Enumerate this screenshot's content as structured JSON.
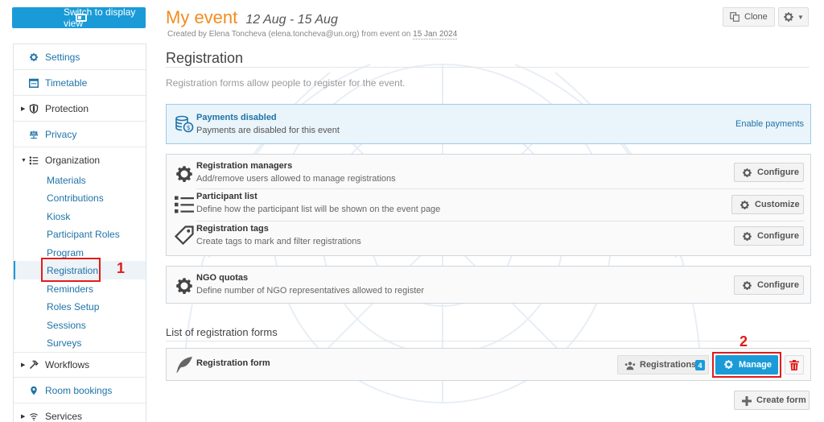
{
  "sidebar": {
    "switch_button": "Switch to display view",
    "items": [
      {
        "label": "Settings",
        "icon": "gear-icon"
      },
      {
        "label": "Timetable",
        "icon": "calendar-icon"
      },
      {
        "label": "Protection",
        "icon": "shield-icon"
      },
      {
        "label": "Privacy",
        "icon": "scales-icon"
      },
      {
        "label": "Organization",
        "icon": "list-icon"
      },
      {
        "label": "Workflows",
        "icon": "hammer-icon"
      },
      {
        "label": "Room bookings",
        "icon": "map-pin-icon"
      },
      {
        "label": "Services",
        "icon": "wifi-icon"
      }
    ],
    "organization_sub": [
      "Materials",
      "Contributions",
      "Kiosk",
      "Participant Roles",
      "Program",
      "Registration",
      "Reminders",
      "Roles Setup",
      "Sessions",
      "Surveys"
    ],
    "active": "Registration"
  },
  "markers": {
    "one": "1",
    "two": "2"
  },
  "header": {
    "title": "My event",
    "dates": "12 Aug - 15 Aug",
    "created_prefix": "Created by Elena Toncheva (elena.toncheva@un.org) from event on ",
    "created_date": "15 Jan 2024",
    "clone_label": "Clone"
  },
  "page": {
    "title": "Registration",
    "intro": "Registration forms allow people to register for the event."
  },
  "payments": {
    "title": "Payments disabled",
    "desc": "Payments are disabled for this event",
    "action": "Enable payments"
  },
  "settings_rows": [
    {
      "title": "Registration managers",
      "desc": "Add/remove users allowed to manage registrations",
      "button": "Configure"
    },
    {
      "title": "Participant list",
      "desc": "Define how the participant list will be shown on the event page",
      "button": "Customize"
    },
    {
      "title": "Registration tags",
      "desc": "Create tags to mark and filter registrations",
      "button": "Configure"
    }
  ],
  "ngo": {
    "title": "NGO quotas",
    "desc": "Define number of NGO representatives allowed to register",
    "button": "Configure"
  },
  "forms": {
    "section_title": "List of registration forms",
    "items": [
      {
        "name": "Registration form",
        "registrations_label": "Registrations",
        "registrations_count": "4",
        "manage_label": "Manage"
      }
    ],
    "create_label": "Create form"
  },
  "colors": {
    "accent": "#1a9bd7",
    "title": "#f28c1e",
    "highlight": "#e21b1b"
  }
}
